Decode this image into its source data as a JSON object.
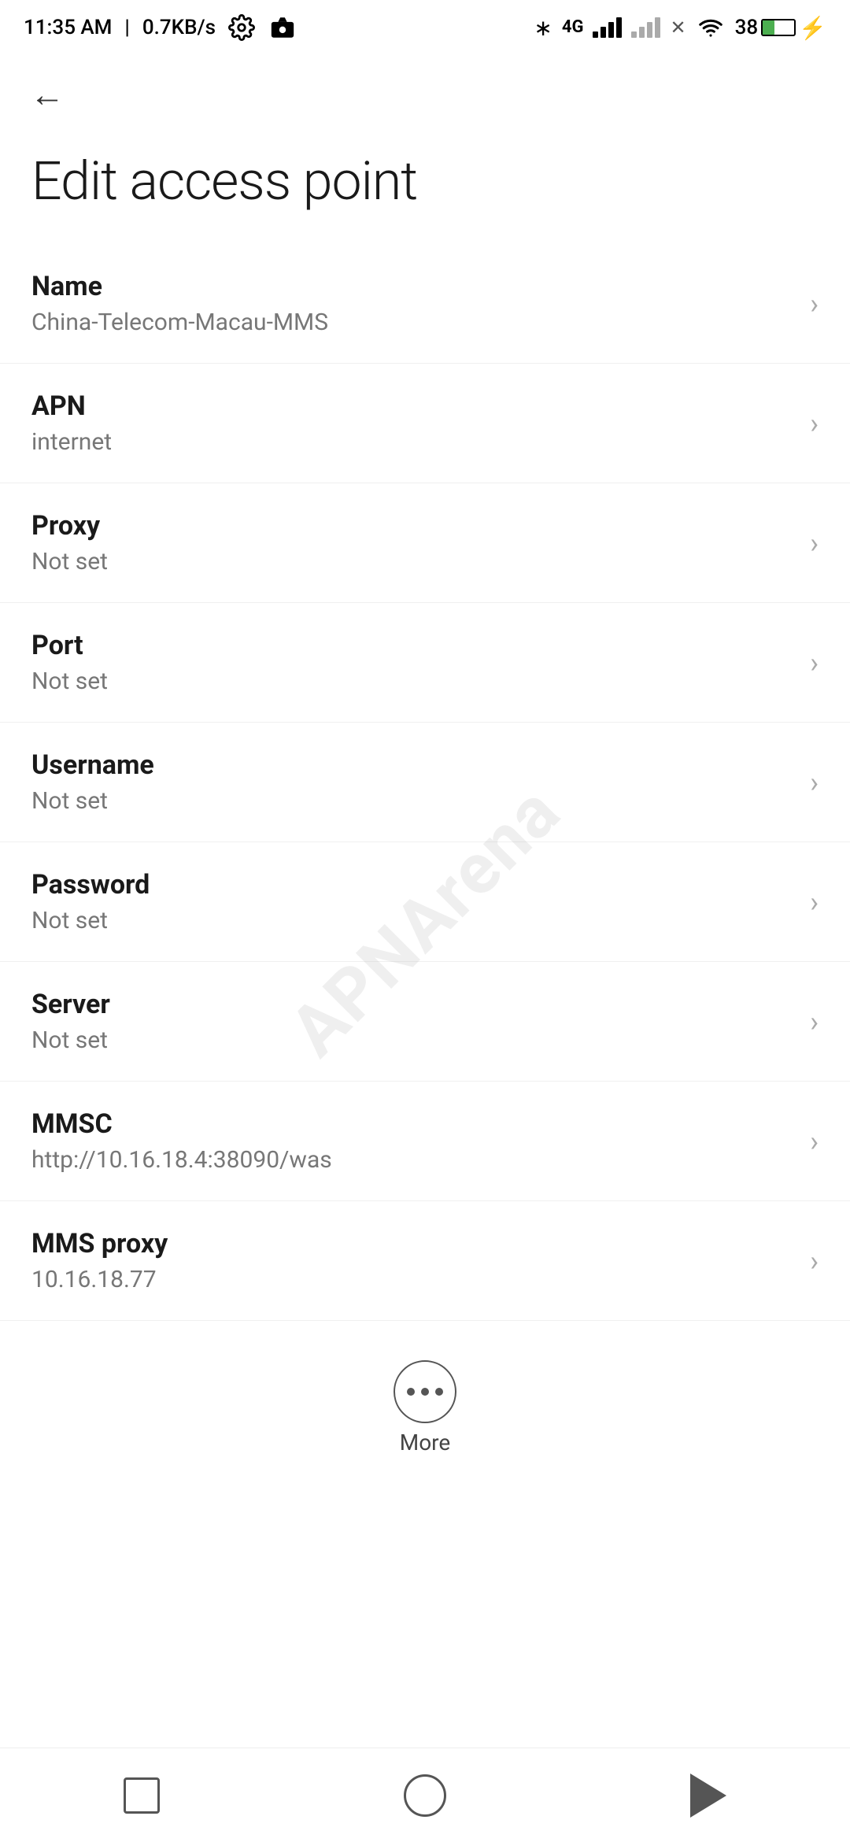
{
  "statusBar": {
    "time": "11:35 AM",
    "speed": "0.7KB/s"
  },
  "nav": {
    "back_label": "←"
  },
  "page": {
    "title": "Edit access point"
  },
  "fields": [
    {
      "label": "Name",
      "value": "China-Telecom-Macau-MMS"
    },
    {
      "label": "APN",
      "value": "internet"
    },
    {
      "label": "Proxy",
      "value": "Not set"
    },
    {
      "label": "Port",
      "value": "Not set"
    },
    {
      "label": "Username",
      "value": "Not set"
    },
    {
      "label": "Password",
      "value": "Not set"
    },
    {
      "label": "Server",
      "value": "Not set"
    },
    {
      "label": "MMSC",
      "value": "http://10.16.18.4:38090/was"
    },
    {
      "label": "MMS proxy",
      "value": "10.16.18.77"
    }
  ],
  "more": {
    "label": "More"
  },
  "watermark": "APNArena",
  "bottomNav": {
    "square_label": "recent",
    "circle_label": "home",
    "triangle_label": "back"
  }
}
